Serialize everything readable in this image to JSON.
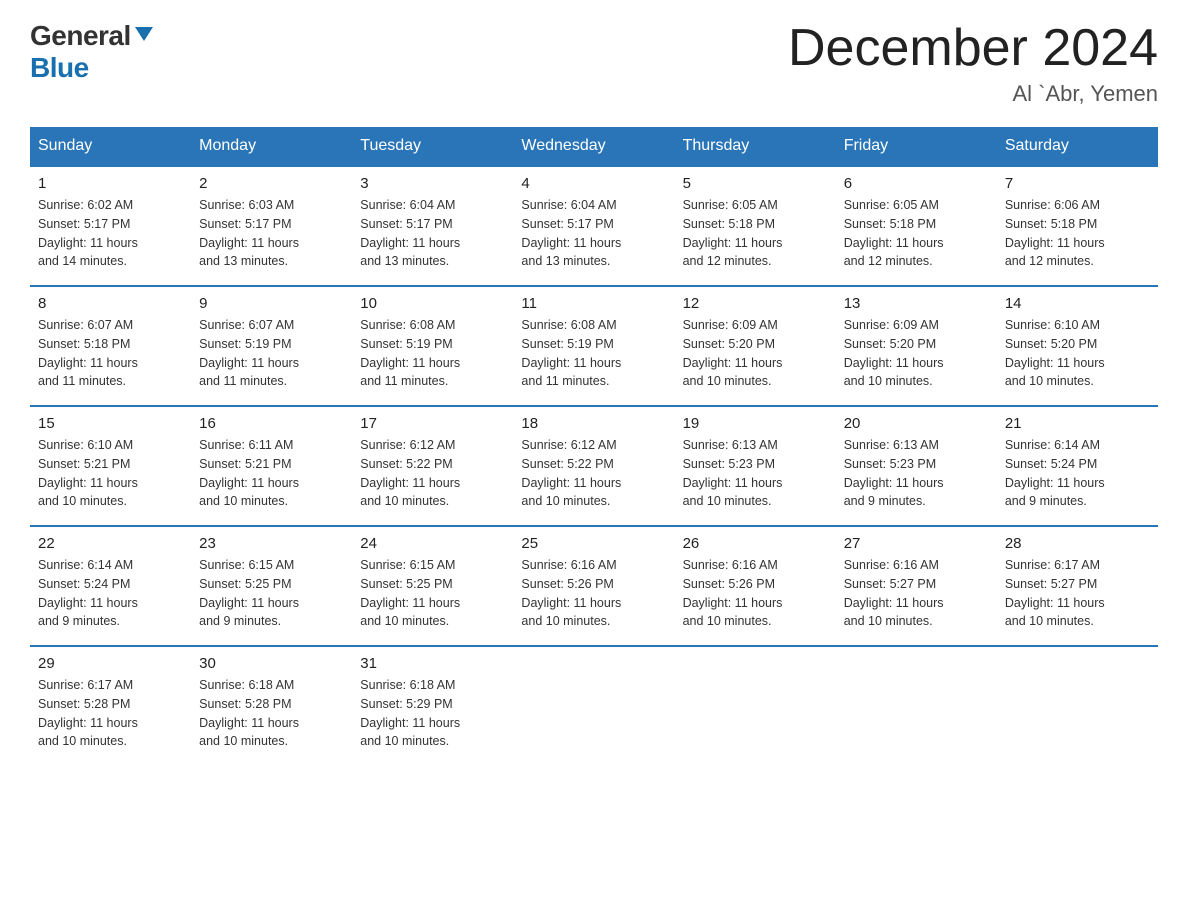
{
  "logo": {
    "general": "General",
    "blue": "Blue",
    "arrow": "▶"
  },
  "title": {
    "month": "December 2024",
    "location": "Al `Abr, Yemen"
  },
  "weekdays": [
    "Sunday",
    "Monday",
    "Tuesday",
    "Wednesday",
    "Thursday",
    "Friday",
    "Saturday"
  ],
  "weeks": [
    [
      {
        "day": "1",
        "info": "Sunrise: 6:02 AM\nSunset: 5:17 PM\nDaylight: 11 hours\nand 14 minutes."
      },
      {
        "day": "2",
        "info": "Sunrise: 6:03 AM\nSunset: 5:17 PM\nDaylight: 11 hours\nand 13 minutes."
      },
      {
        "day": "3",
        "info": "Sunrise: 6:04 AM\nSunset: 5:17 PM\nDaylight: 11 hours\nand 13 minutes."
      },
      {
        "day": "4",
        "info": "Sunrise: 6:04 AM\nSunset: 5:17 PM\nDaylight: 11 hours\nand 13 minutes."
      },
      {
        "day": "5",
        "info": "Sunrise: 6:05 AM\nSunset: 5:18 PM\nDaylight: 11 hours\nand 12 minutes."
      },
      {
        "day": "6",
        "info": "Sunrise: 6:05 AM\nSunset: 5:18 PM\nDaylight: 11 hours\nand 12 minutes."
      },
      {
        "day": "7",
        "info": "Sunrise: 6:06 AM\nSunset: 5:18 PM\nDaylight: 11 hours\nand 12 minutes."
      }
    ],
    [
      {
        "day": "8",
        "info": "Sunrise: 6:07 AM\nSunset: 5:18 PM\nDaylight: 11 hours\nand 11 minutes."
      },
      {
        "day": "9",
        "info": "Sunrise: 6:07 AM\nSunset: 5:19 PM\nDaylight: 11 hours\nand 11 minutes."
      },
      {
        "day": "10",
        "info": "Sunrise: 6:08 AM\nSunset: 5:19 PM\nDaylight: 11 hours\nand 11 minutes."
      },
      {
        "day": "11",
        "info": "Sunrise: 6:08 AM\nSunset: 5:19 PM\nDaylight: 11 hours\nand 11 minutes."
      },
      {
        "day": "12",
        "info": "Sunrise: 6:09 AM\nSunset: 5:20 PM\nDaylight: 11 hours\nand 10 minutes."
      },
      {
        "day": "13",
        "info": "Sunrise: 6:09 AM\nSunset: 5:20 PM\nDaylight: 11 hours\nand 10 minutes."
      },
      {
        "day": "14",
        "info": "Sunrise: 6:10 AM\nSunset: 5:20 PM\nDaylight: 11 hours\nand 10 minutes."
      }
    ],
    [
      {
        "day": "15",
        "info": "Sunrise: 6:10 AM\nSunset: 5:21 PM\nDaylight: 11 hours\nand 10 minutes."
      },
      {
        "day": "16",
        "info": "Sunrise: 6:11 AM\nSunset: 5:21 PM\nDaylight: 11 hours\nand 10 minutes."
      },
      {
        "day": "17",
        "info": "Sunrise: 6:12 AM\nSunset: 5:22 PM\nDaylight: 11 hours\nand 10 minutes."
      },
      {
        "day": "18",
        "info": "Sunrise: 6:12 AM\nSunset: 5:22 PM\nDaylight: 11 hours\nand 10 minutes."
      },
      {
        "day": "19",
        "info": "Sunrise: 6:13 AM\nSunset: 5:23 PM\nDaylight: 11 hours\nand 10 minutes."
      },
      {
        "day": "20",
        "info": "Sunrise: 6:13 AM\nSunset: 5:23 PM\nDaylight: 11 hours\nand 9 minutes."
      },
      {
        "day": "21",
        "info": "Sunrise: 6:14 AM\nSunset: 5:24 PM\nDaylight: 11 hours\nand 9 minutes."
      }
    ],
    [
      {
        "day": "22",
        "info": "Sunrise: 6:14 AM\nSunset: 5:24 PM\nDaylight: 11 hours\nand 9 minutes."
      },
      {
        "day": "23",
        "info": "Sunrise: 6:15 AM\nSunset: 5:25 PM\nDaylight: 11 hours\nand 9 minutes."
      },
      {
        "day": "24",
        "info": "Sunrise: 6:15 AM\nSunset: 5:25 PM\nDaylight: 11 hours\nand 10 minutes."
      },
      {
        "day": "25",
        "info": "Sunrise: 6:16 AM\nSunset: 5:26 PM\nDaylight: 11 hours\nand 10 minutes."
      },
      {
        "day": "26",
        "info": "Sunrise: 6:16 AM\nSunset: 5:26 PM\nDaylight: 11 hours\nand 10 minutes."
      },
      {
        "day": "27",
        "info": "Sunrise: 6:16 AM\nSunset: 5:27 PM\nDaylight: 11 hours\nand 10 minutes."
      },
      {
        "day": "28",
        "info": "Sunrise: 6:17 AM\nSunset: 5:27 PM\nDaylight: 11 hours\nand 10 minutes."
      }
    ],
    [
      {
        "day": "29",
        "info": "Sunrise: 6:17 AM\nSunset: 5:28 PM\nDaylight: 11 hours\nand 10 minutes."
      },
      {
        "day": "30",
        "info": "Sunrise: 6:18 AM\nSunset: 5:28 PM\nDaylight: 11 hours\nand 10 minutes."
      },
      {
        "day": "31",
        "info": "Sunrise: 6:18 AM\nSunset: 5:29 PM\nDaylight: 11 hours\nand 10 minutes."
      },
      null,
      null,
      null,
      null
    ]
  ]
}
